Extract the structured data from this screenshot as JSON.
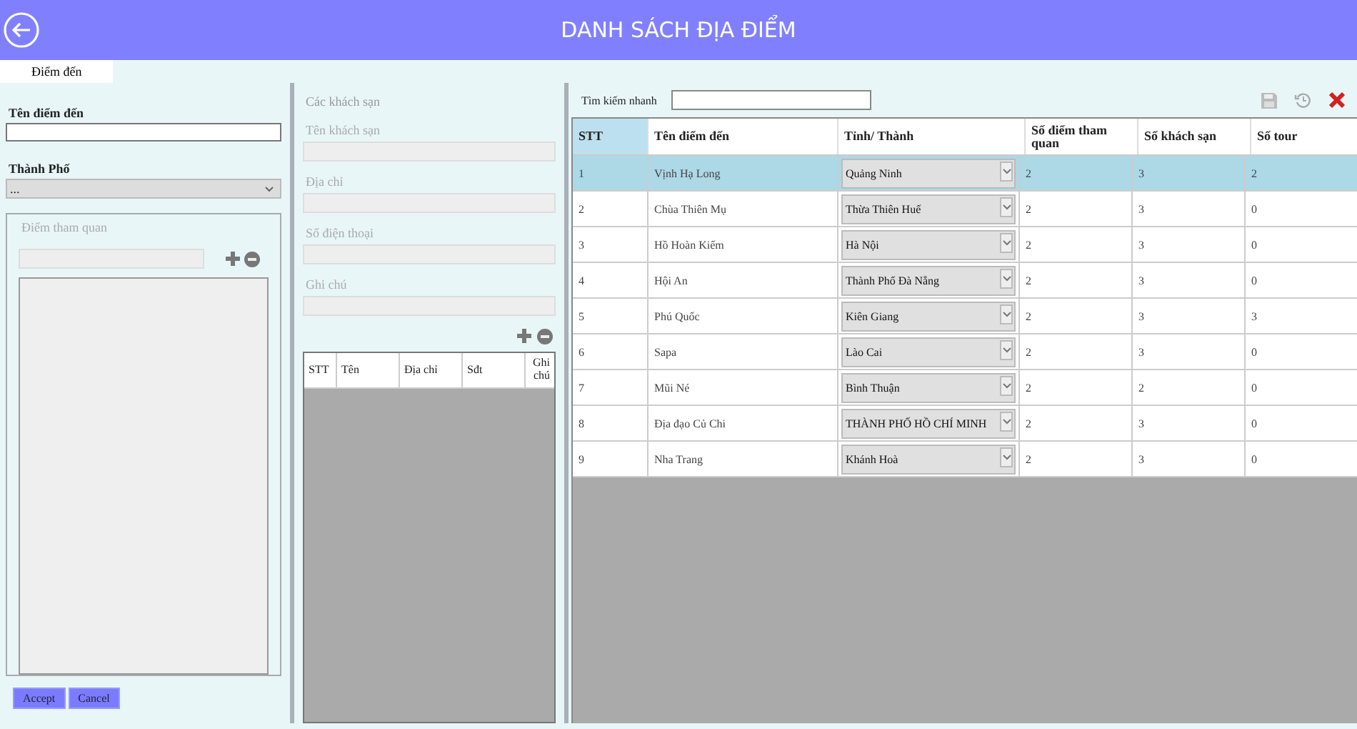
{
  "header": {
    "title": "DANH SÁCH ĐỊA ĐIỂM"
  },
  "tabs": [
    {
      "label": "Điểm đến",
      "selected": true
    }
  ],
  "destination_form": {
    "name_label": "Tên điểm đến",
    "city_label": "Thành Phố",
    "city_value": "...",
    "attractions_title": "Điểm tham quan",
    "buttons": [
      "Accept",
      "Cancel"
    ]
  },
  "hotels": {
    "title": "Các khách sạn",
    "fields": [
      {
        "label": "Tên khách sạn",
        "disabled": true
      },
      {
        "label": "Địa chỉ",
        "disabled": true
      },
      {
        "label": "Số điện thoại",
        "disabled": true
      },
      {
        "label": "Ghi chú",
        "disabled": true
      }
    ],
    "columns": [
      "STT",
      "Tên",
      "Địa chỉ",
      "Sđt",
      "Ghi chú"
    ]
  },
  "search": {
    "label": "Tìm kiếm nhanh"
  },
  "table": {
    "columns": [
      "STT",
      "Tên điểm đến",
      "Tỉnh/ Thành",
      "Số điểm tham quan",
      "Số khách sạn",
      "Số tour"
    ],
    "rows": [
      {
        "stt": "1",
        "name": "Vịnh Hạ Long",
        "province": "Quảng Ninh",
        "attractions": "2",
        "hotels": "3",
        "tours": "2",
        "selected": true
      },
      {
        "stt": "2",
        "name": "Chùa Thiên Mụ",
        "province": "Thừa Thiên Huế",
        "attractions": "2",
        "hotels": "3",
        "tours": "0",
        "selected": false
      },
      {
        "stt": "3",
        "name": "Hồ Hoàn Kiếm",
        "province": "Hà Nội",
        "attractions": "2",
        "hotels": "3",
        "tours": "0",
        "selected": false
      },
      {
        "stt": "4",
        "name": "Hội An",
        "province": "Thành Phố Đà Nẵng",
        "attractions": "2",
        "hotels": "3",
        "tours": "0",
        "selected": false
      },
      {
        "stt": "5",
        "name": "Phú Quốc",
        "province": "Kiên Giang",
        "attractions": "2",
        "hotels": "3",
        "tours": "3",
        "selected": false
      },
      {
        "stt": "6",
        "name": "Sapa",
        "province": "Lào Cai",
        "attractions": "2",
        "hotels": "3",
        "tours": "0",
        "selected": false
      },
      {
        "stt": "7",
        "name": "Mũi Né",
        "province": "Bình Thuận",
        "attractions": "2",
        "hotels": "2",
        "tours": "0",
        "selected": false
      },
      {
        "stt": "8",
        "name": "Địa đạo Củ Chi",
        "province": "THÀNH PHỐ HỒ CHÍ MINH",
        "attractions": "2",
        "hotels": "3",
        "tours": "0",
        "selected": false
      },
      {
        "stt": "9",
        "name": "Nha Trang",
        "province": "Khánh Hoà",
        "attractions": "2",
        "hotels": "3",
        "tours": "0",
        "selected": false
      }
    ]
  }
}
